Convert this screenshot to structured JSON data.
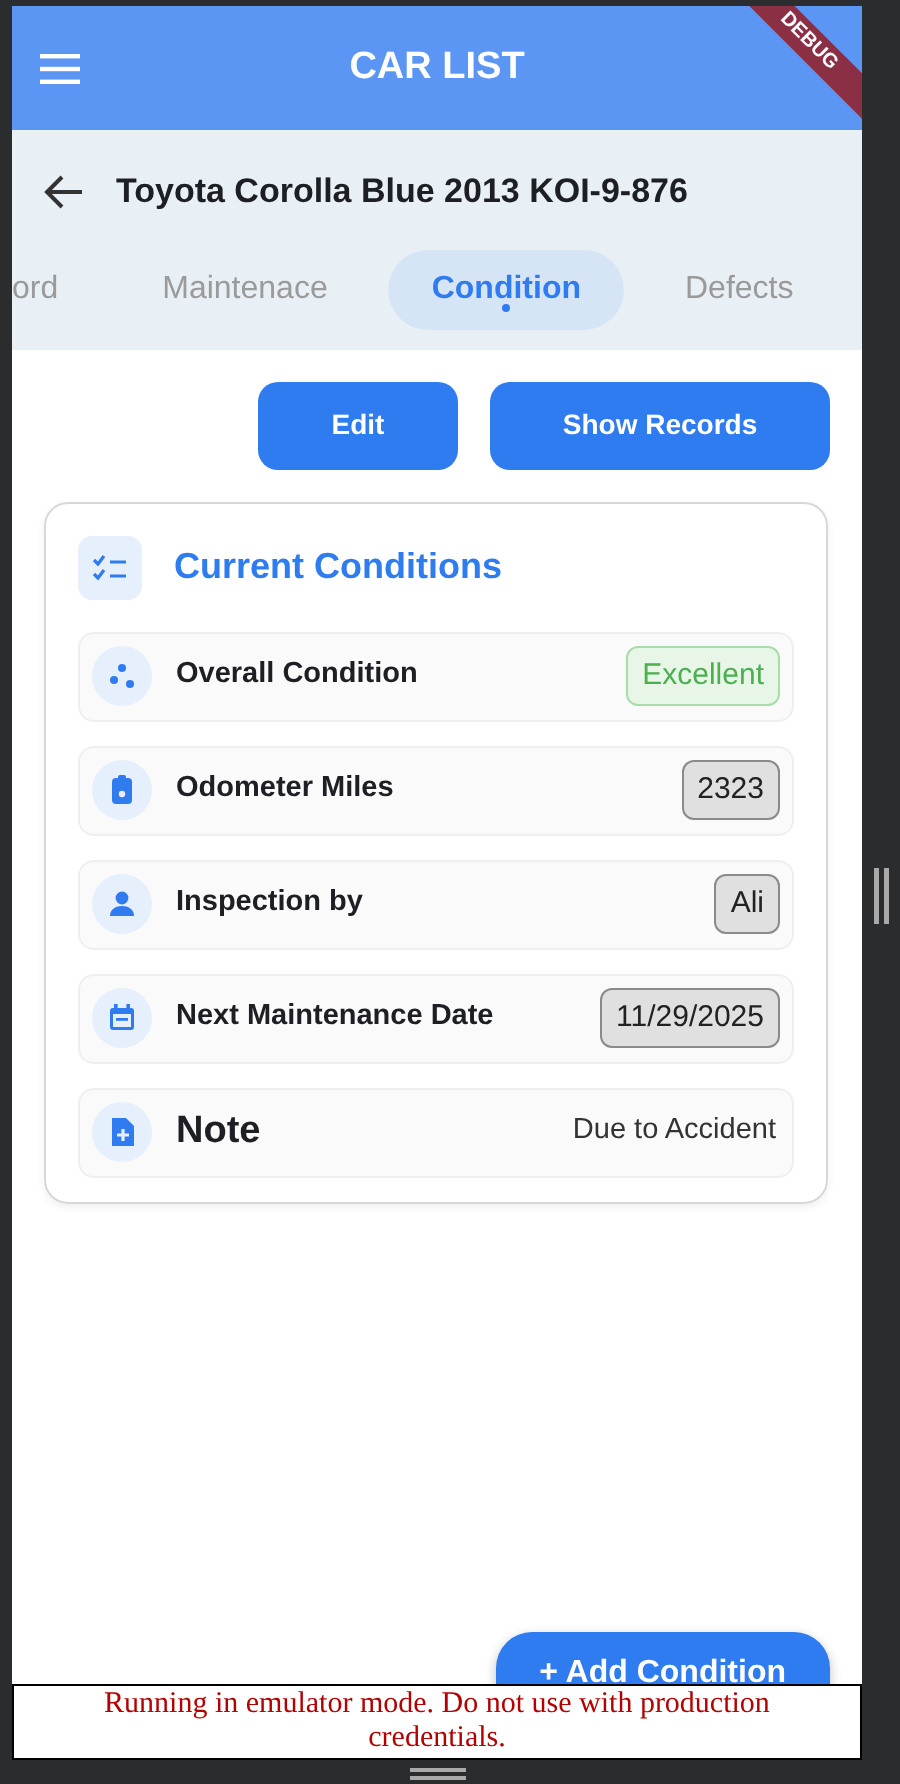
{
  "app_bar": {
    "title": "CAR LIST",
    "debug_banner": "DEBUG"
  },
  "vehicle": {
    "title": "Toyota Corolla Blue 2013 KOI-9-876"
  },
  "tabs": [
    {
      "label": "ord",
      "selected": false
    },
    {
      "label": "Maintenace",
      "selected": false
    },
    {
      "label": "Condition",
      "selected": true
    },
    {
      "label": "Defects",
      "selected": false
    }
  ],
  "actions": [
    "Edit",
    "Show Records"
  ],
  "card": {
    "title": "Current Conditions",
    "rows": [
      {
        "label": "Overall Condition",
        "value": "Excellent",
        "kind": "status"
      },
      {
        "label": "Odometer Miles",
        "value": "2323",
        "kind": "chip"
      },
      {
        "label": "Inspection by",
        "value": "Ali",
        "kind": "chip"
      },
      {
        "label": "Next Maintenance Date",
        "value": "11/29/2025",
        "kind": "chip"
      },
      {
        "label": "Note",
        "value": "Due to Accident",
        "kind": "plain"
      }
    ]
  },
  "fab": {
    "label": "+ Add Condition"
  },
  "emulator_notice": "Running in emulator mode. Do not use with production credentials."
}
